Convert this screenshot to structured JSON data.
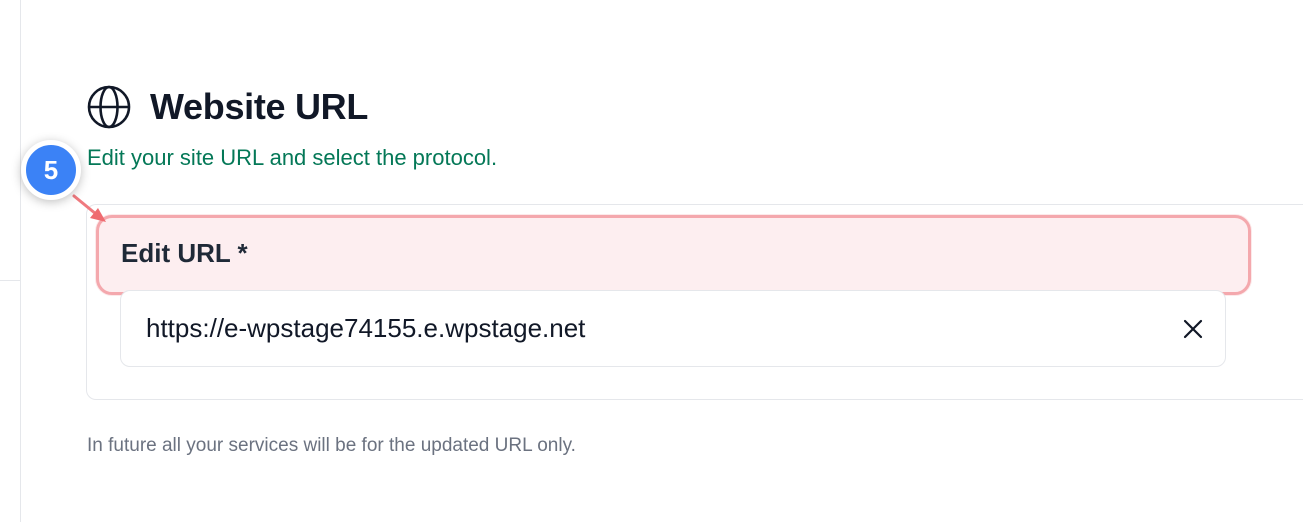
{
  "section": {
    "title": "Website URL",
    "subtitle": "Edit your site URL and select the protocol.",
    "icon": "globe-icon"
  },
  "field": {
    "label": "Edit URL *",
    "value": "https://e-wpstage74155.e.wpstage.net",
    "clear_icon": "close-icon"
  },
  "helper": {
    "text": "In future all your services will be for the updated URL only."
  },
  "annotation": {
    "step_number": "5"
  },
  "colors": {
    "subtitle": "#047857",
    "highlight_border": "#f4a8ad",
    "highlight_fill": "#fdeef0",
    "marker": "#3b82f6"
  }
}
